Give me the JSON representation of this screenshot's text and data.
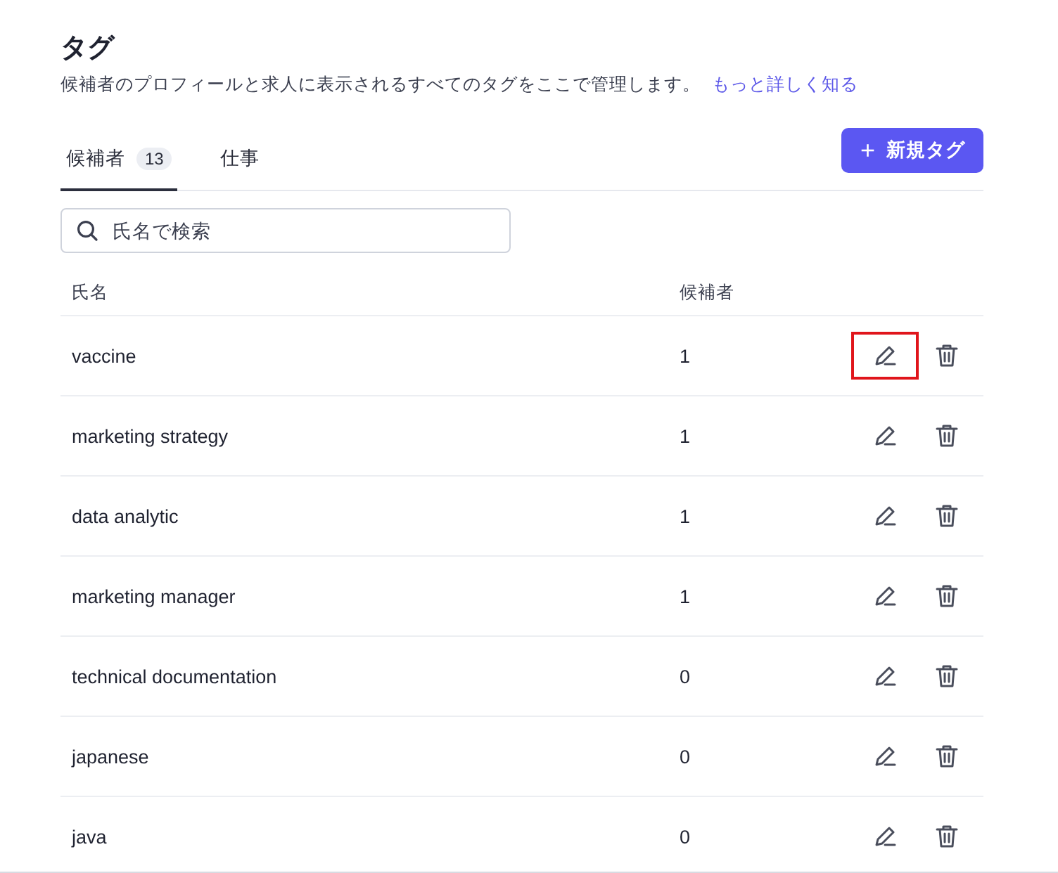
{
  "header": {
    "title": "タグ",
    "description": "候補者のプロフィールと求人に表示されるすべてのタグをここで管理します。",
    "link": "もっと詳しく知る"
  },
  "tabs": [
    {
      "label": "候補者",
      "count": "13",
      "selected": true
    },
    {
      "label": "仕事",
      "selected": false
    }
  ],
  "new_button": {
    "icon": "+",
    "label": "新規タグ"
  },
  "search": {
    "placeholder": "氏名で検索"
  },
  "table": {
    "columns": [
      "氏名",
      "候補者"
    ],
    "rows": [
      {
        "name": "vaccine",
        "count": "1",
        "highlighted": true
      },
      {
        "name": "marketing strategy",
        "count": "1",
        "highlighted": false
      },
      {
        "name": "data analytic",
        "count": "1",
        "highlighted": false
      },
      {
        "name": "marketing manager",
        "count": "1",
        "highlighted": false
      },
      {
        "name": "technical documentation",
        "count": "0",
        "highlighted": false
      },
      {
        "name": "japanese",
        "count": "0",
        "highlighted": false
      },
      {
        "name": "java",
        "count": "0",
        "highlighted": false
      }
    ]
  }
}
